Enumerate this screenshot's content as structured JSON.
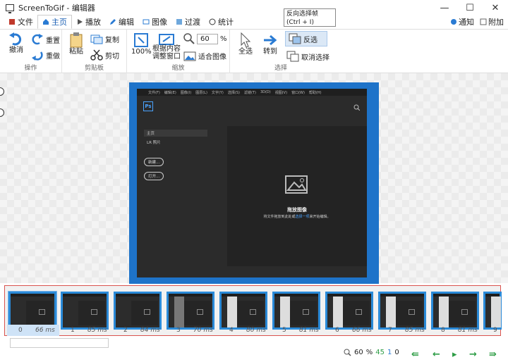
{
  "window": {
    "title": "ScreenToGif - 编辑器",
    "minimize": "—",
    "maximize": "☐",
    "close": "✕"
  },
  "tabs": [
    {
      "label": "文件",
      "icon": "file-icon"
    },
    {
      "label": "主页",
      "icon": "home-icon",
      "active": true
    },
    {
      "label": "播放",
      "icon": "play-icon"
    },
    {
      "label": "编辑",
      "icon": "pencil-icon"
    },
    {
      "label": "图像",
      "icon": "image-icon"
    },
    {
      "label": "过渡",
      "icon": "transition-icon"
    },
    {
      "label": "统计",
      "icon": "stats-icon"
    }
  ],
  "menu_right": {
    "notify": "通知",
    "extra": "附加"
  },
  "tooltip": {
    "line1": "反向选择帧",
    "line2": "(Ctrl + I)"
  },
  "ribbon": {
    "ops": {
      "undo": "撤消",
      "redo": "重置",
      "reset": "重做",
      "label": "操作"
    },
    "clipboard": {
      "paste": "粘贴",
      "copy": "复制",
      "cut": "剪切",
      "label": "剪贴板"
    },
    "zoom": {
      "hundred": "100%",
      "fit": "根据内容调整窗口",
      "fit_image": "适合图像",
      "value": "60",
      "percent": "%",
      "label": "缩放"
    },
    "select": {
      "all": "全选",
      "goto": "转到",
      "invert": "反选",
      "deselect": "取消选择",
      "label": "选择"
    }
  },
  "preview": {
    "menu_items": [
      "文件(F)",
      "编辑(E)",
      "图像(I)",
      "图层(L)",
      "文字(Y)",
      "选择(S)",
      "滤镜(T)",
      "3D(D)",
      "视图(V)",
      "窗口(W)",
      "帮助(H)"
    ],
    "logo": "Ps",
    "sidebar_home": "主页",
    "sidebar_lr": "LR 照片",
    "btn_new": "新建...",
    "btn_open": "打开...",
    "drop_title": "拖放图像",
    "drop_sub": "将文件拖放到此处或",
    "drop_link": "选择一项",
    "drop_tail": "来开始编辑。"
  },
  "frames": [
    {
      "index": "0",
      "ms": "66 ms"
    },
    {
      "index": "1",
      "ms": "85 ms"
    },
    {
      "index": "2",
      "ms": "84 ms"
    },
    {
      "index": "3",
      "ms": "70 ms"
    },
    {
      "index": "4",
      "ms": "80 ms"
    },
    {
      "index": "5",
      "ms": "81 ms"
    },
    {
      "index": "6",
      "ms": "66 ms"
    },
    {
      "index": "7",
      "ms": "85 ms"
    },
    {
      "index": "8",
      "ms": "81 ms"
    },
    {
      "index": "9",
      "ms": ""
    }
  ],
  "status": {
    "zoom": "60",
    "percent": "%",
    "count": "45",
    "selected": "1",
    "current": "0"
  },
  "colors": {
    "accent": "#1a73c9",
    "selection_border": "#d9534f",
    "nav_green": "#2e9d46"
  }
}
